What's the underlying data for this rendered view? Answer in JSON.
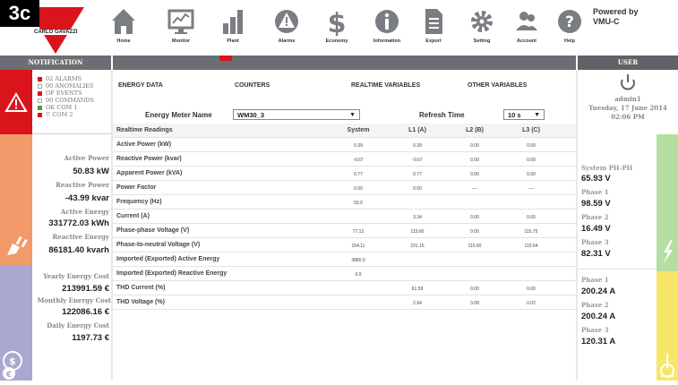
{
  "figure_label": "3c",
  "logo": {
    "text": "CARLO GAVAZZI"
  },
  "brand": {
    "line1": "Powered by",
    "line2": "VMU-C"
  },
  "nav": [
    {
      "label": "Home",
      "icon": "home-icon"
    },
    {
      "label": "Monitor",
      "icon": "monitor-icon"
    },
    {
      "label": "Plant",
      "icon": "plant-icon"
    },
    {
      "label": "Alarms",
      "icon": "alarm-icon"
    },
    {
      "label": "Economy",
      "icon": "dollar-icon"
    },
    {
      "label": "Information",
      "icon": "info-icon"
    },
    {
      "label": "Export",
      "icon": "export-icon"
    },
    {
      "label": "Setting",
      "icon": "gear-icon"
    },
    {
      "label": "Account",
      "icon": "account-icon"
    },
    {
      "label": "Help",
      "icon": "help-icon"
    }
  ],
  "headers": {
    "notification": "NOTIFICATION",
    "user": "USER"
  },
  "notifications": [
    {
      "text": "02  ALARMS",
      "color": "#d9141b"
    },
    {
      "text": "00  ANOMALIES",
      "color": "#ffffff"
    },
    {
      "text": "OF  EVENTS",
      "color": "#d9141b"
    },
    {
      "text": "00  COMMANDS",
      "color": "#ffffff"
    },
    {
      "text": "OK  COM 1",
      "color": "#3aa635"
    },
    {
      "text": "!!    COM 2",
      "color": "#d9141b"
    }
  ],
  "left": {
    "active_power_label": "Active Power",
    "active_power": "50.83 kW",
    "reactive_power_label": "Reactive Power",
    "reactive_power": "-43.99 kvar",
    "active_energy_label": "Active Energy",
    "active_energy": "331772.03 kWh",
    "reactive_energy_label": "Reactive Energy",
    "reactive_energy": "86181.40 kvarh",
    "yearly_cost_label": "Yearly Energy Cost",
    "yearly_cost": "213991.59 €",
    "monthly_cost_label": "Monthly Energy Cost",
    "monthly_cost": "122086.16 €",
    "daily_cost_label": "Daily Energy Cost",
    "daily_cost": "1197.73 €"
  },
  "tabs": [
    "ENERGY DATA",
    "COUNTERS",
    "REALTIME VARIABLES",
    "OTHER VARIABLES"
  ],
  "meter": {
    "label": "Energy Meter Name",
    "value": "WM30_3",
    "refresh_label": "Refresh Time",
    "refresh_value": "10 s"
  },
  "table": {
    "headers": [
      "Realtime Readings",
      "System",
      "L1 (A)",
      "L2 (B)",
      "L3 (C)"
    ],
    "rows": [
      [
        "Active Power (kW)",
        "0.39",
        "0.39",
        "0.00",
        "0.00"
      ],
      [
        "Reactive Power (kvar)",
        "-0.67",
        "-0.67",
        "0.00",
        "0.00"
      ],
      [
        "Apparent Power (kVA)",
        "0.77",
        "0.77",
        "0.00",
        "0.00"
      ],
      [
        "Power Factor",
        "0.50",
        "0.50",
        "—",
        "—"
      ],
      [
        "Frequency (Hz)",
        "50.0",
        "",
        "",
        ""
      ],
      [
        "Current (A)",
        "",
        "3.34",
        "0.00",
        "0.00"
      ],
      [
        "Phase-phase Voltage (V)",
        "77.12",
        "115.60",
        "0.00",
        "115.75"
      ],
      [
        "Phase-to-neutral Voltage (V)",
        "154.11",
        "231.15",
        "115.60",
        "115.54"
      ],
      [
        "Imported (Exported) Active Energy",
        "3880.0",
        "",
        "",
        ""
      ],
      [
        "Imported (Exported) Reactive Energy",
        "0.0",
        "",
        "",
        ""
      ],
      [
        "THD Current (%)",
        "",
        "61.59",
        "0.00",
        "0.00"
      ],
      [
        "THD Voltage (%)",
        "",
        "2.94",
        "3.08",
        "0.02"
      ]
    ]
  },
  "user": {
    "name": "admin1",
    "date": "Tuesday, 17 June 2014",
    "time": "02:06 PM"
  },
  "right": {
    "voltage_title": "System PH-PH",
    "system_v": "65.93 V",
    "phase1_label": "Phase 1",
    "phase1_v": "98.59 V",
    "phase2_label": "Phase 2",
    "phase2_v": "16.49 V",
    "phase3_label": "Phase 3",
    "phase3_v": "82.31 V",
    "cur_phase1_label": "Phase 1",
    "cur_phase1": "200.24 A",
    "cur_phase2_label": "Phase 2",
    "cur_phase2": "200.24 A",
    "cur_phase3_label": "Phase 3",
    "cur_phase3": "120.31 A"
  }
}
